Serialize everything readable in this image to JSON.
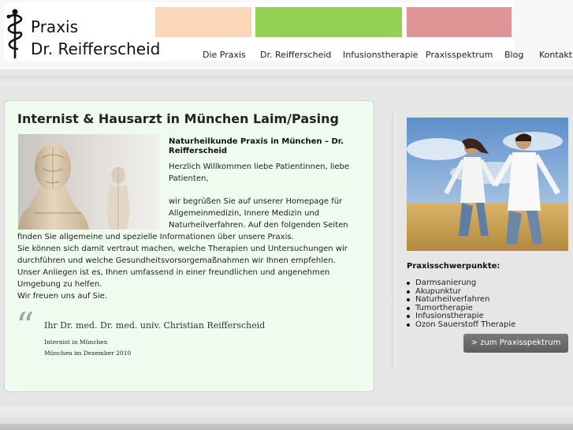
{
  "logo": {
    "line1": "Praxis",
    "line2": "Dr. Reifferscheid",
    "icon": "caduceus-icon"
  },
  "header_colors": [
    "#fcd6b8",
    "#92d154",
    "#dd9595"
  ],
  "nav": [
    "Die Praxis",
    "Dr. Reifferscheid",
    "Infusionstherapie",
    "Praxisspektrum",
    "Blog",
    "Kontakt"
  ],
  "main": {
    "title": "Internist & Hausarzt in München Laim/Pasing",
    "intro_title": "Naturheilkunde Praxis in München – Dr. Reifferscheid",
    "greeting": "Herzlich Willkommen liebe Patientinnen, liebe Patienten,",
    "para_a": "wir begrüßen Sie auf unserer Homepage für Allgemeinmedizin, Innere Medizin und Naturheilverfahren. Auf den folgenden Seiten",
    "para_b_lines": [
      "finden Sie allgemeine und spezielle Informationen über unsere Praxis.",
      "Sie können sich damit vertraut machen, welche Therapien und Untersuchungen wir durchführen und welche Gesundheitsvorsorgemaßnahmen wir Ihnen empfehlen.",
      "Unser Anliegen ist es, Ihnen umfassend in einer freundlichen und angenehmen Umgebung zu helfen.",
      "Wir freuen uns auf Sie."
    ],
    "quote_mark": "“",
    "signature": "Ihr Dr. med. Dr. med. univ. Christian Reifferscheid",
    "role": "Internist in München",
    "date": "München im Dezember 2010"
  },
  "sidebar": {
    "heading": "Praxisschwerpunkte:",
    "items": [
      "Darmsanierung",
      "Akupunktur",
      "Naturheilverfahren",
      "Tumortherapie",
      "Infusionstherapie",
      "Ozon Sauerstoff Therapie"
    ],
    "button": "> zum Praxisspektrum"
  }
}
